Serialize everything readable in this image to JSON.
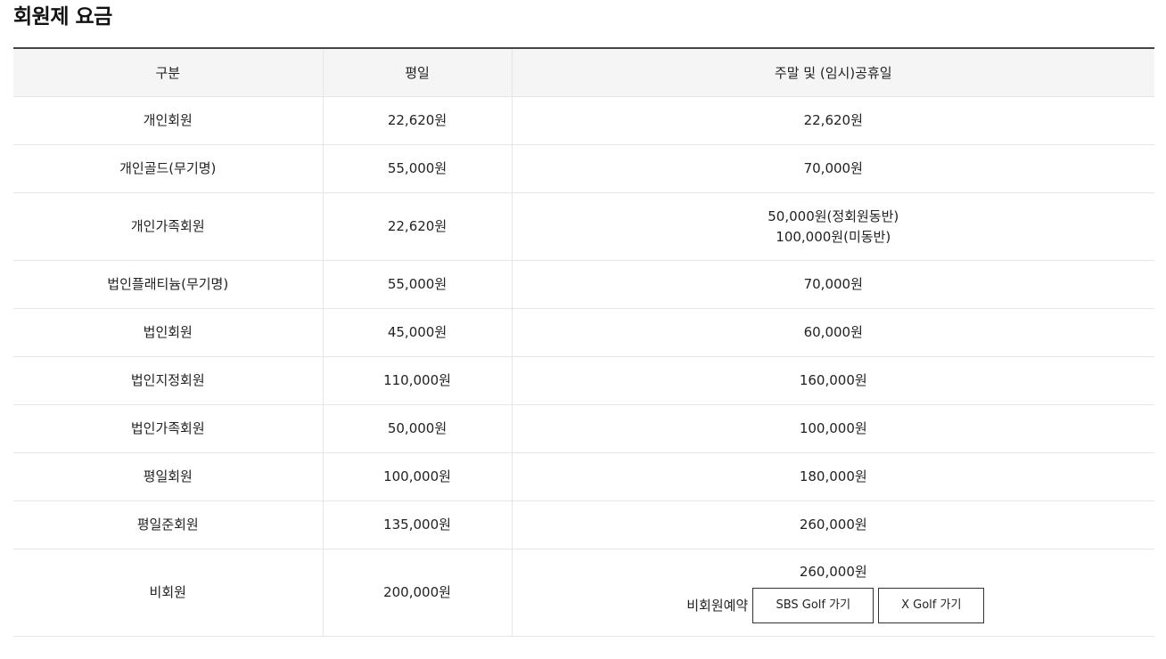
{
  "page_title": "회원제 요금",
  "table": {
    "headers": [
      "구분",
      "평일",
      "주말 및 (임시)공휴일"
    ],
    "rows": [
      {
        "category": "개인회원",
        "weekday": "22,620원",
        "weekend": [
          "22,620원"
        ]
      },
      {
        "category": "개인골드(무기명)",
        "weekday": "55,000원",
        "weekend": [
          "70,000원"
        ]
      },
      {
        "category": "개인가족회원",
        "weekday": "22,620원",
        "weekend": [
          "50,000원(정회원동반)",
          "100,000원(미동반)"
        ]
      },
      {
        "category": "법인플래티늄(무기명)",
        "weekday": "55,000원",
        "weekend": [
          "70,000원"
        ]
      },
      {
        "category": "법인회원",
        "weekday": "45,000원",
        "weekend": [
          "60,000원"
        ]
      },
      {
        "category": "법인지정회원",
        "weekday": "110,000원",
        "weekend": [
          "160,000원"
        ]
      },
      {
        "category": "법인가족회원",
        "weekday": "50,000원",
        "weekend": [
          "100,000원"
        ]
      },
      {
        "category": "평일회원",
        "weekday": "100,000원",
        "weekend": [
          "180,000원"
        ]
      },
      {
        "category": "평일준회원",
        "weekday": "135,000원",
        "weekend": [
          "260,000원"
        ]
      }
    ],
    "nonmember": {
      "category": "비회원",
      "weekday": "200,000원",
      "weekend": "260,000원",
      "reserve_label": "비회원예약",
      "sbs_button": "SBS Golf 가기",
      "xgolf_button": "X Golf 가기"
    }
  }
}
